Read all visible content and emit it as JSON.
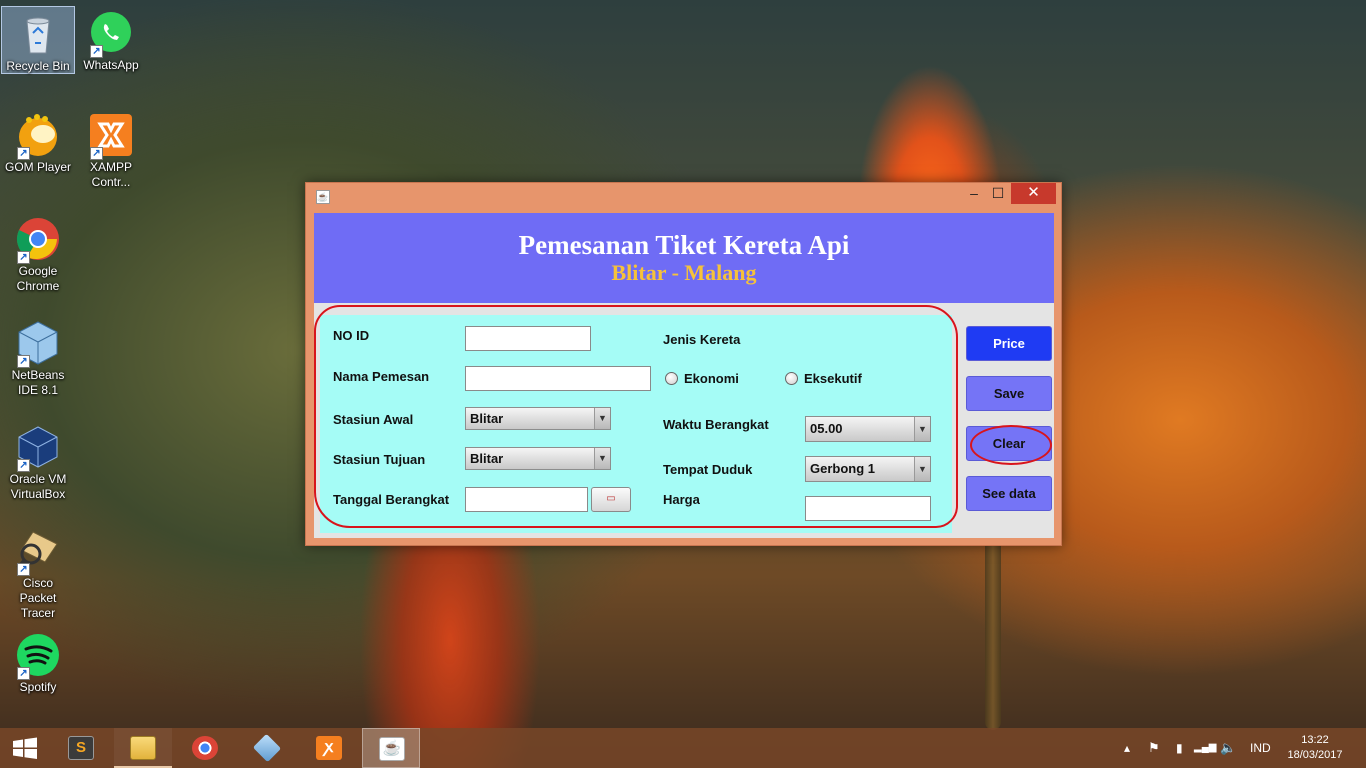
{
  "desktop": {
    "icons": [
      {
        "label": "Recycle Bin"
      },
      {
        "label": "WhatsApp"
      },
      {
        "label": "GOM Player"
      },
      {
        "label": "XAMPP Contr..."
      },
      {
        "label": "Google Chrome"
      },
      {
        "label": "NetBeans IDE 8.1"
      },
      {
        "label": "Oracle VM VirtualBox"
      },
      {
        "label": "Cisco Packet Tracer"
      },
      {
        "label": "Spotify"
      }
    ]
  },
  "window": {
    "header_title": "Pemesanan Tiket Kereta Api",
    "header_subtitle": "Blitar - Malang",
    "form": {
      "no_id_label": "NO ID",
      "no_id_value": "",
      "nama_label": "Nama Pemesan",
      "nama_value": "",
      "stasiun_awal_label": "Stasiun Awal",
      "stasiun_awal_value": "Blitar",
      "stasiun_tujuan_label": "Stasiun Tujuan",
      "stasiun_tujuan_value": "Blitar",
      "tanggal_label": "Tanggal Berangkat",
      "tanggal_value": "",
      "jenis_label": "Jenis Kereta",
      "radio_ekonomi": "Ekonomi",
      "radio_eksekutif": "Eksekutif",
      "waktu_label": "Waktu Berangkat",
      "waktu_value": "05.00",
      "tempat_label": "Tempat Duduk",
      "tempat_value": "Gerbong 1",
      "harga_label": "Harga",
      "harga_value": ""
    },
    "buttons": {
      "price": "Price",
      "save": "Save",
      "clear": "Clear",
      "see_data": "See data"
    }
  },
  "taskbar": {
    "language": "IND",
    "time": "13:22",
    "date": "18/03/2017"
  },
  "colors": {
    "header_bg": "#6f6cf5",
    "subtitle": "#f6c23a",
    "panel_bg": "#a5fcf6",
    "price_button": "#1f3bf3",
    "button_bg": "#7574f6",
    "annotation_red": "#d8141c"
  }
}
